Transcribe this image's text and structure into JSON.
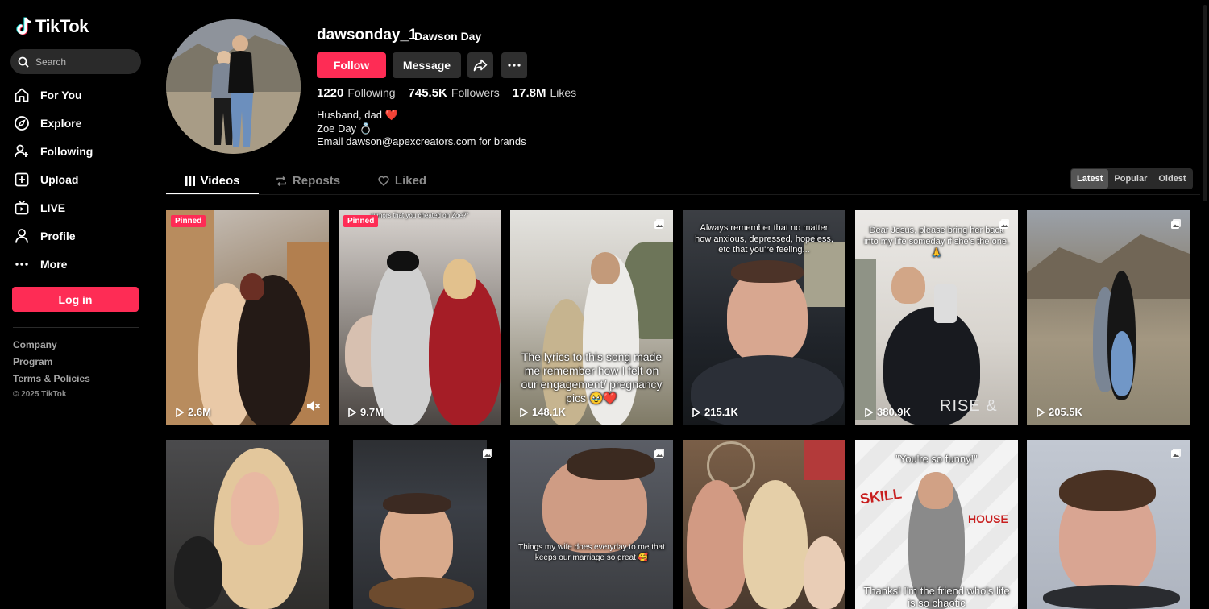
{
  "app": {
    "brand": "TikTok"
  },
  "sidebar": {
    "search_placeholder": "Search",
    "nav": [
      {
        "label": "For You",
        "icon": "home-icon"
      },
      {
        "label": "Explore",
        "icon": "compass-icon"
      },
      {
        "label": "Following",
        "icon": "user-plus-icon"
      },
      {
        "label": "Upload",
        "icon": "upload-icon"
      },
      {
        "label": "LIVE",
        "icon": "live-tv-icon"
      },
      {
        "label": "Profile",
        "icon": "person-icon"
      },
      {
        "label": "More",
        "icon": "more-dots-icon"
      }
    ],
    "login_label": "Log in",
    "footer": {
      "company": "Company",
      "program": "Program",
      "terms": "Terms & Policies",
      "copyright": "© 2025 TikTok"
    }
  },
  "profile": {
    "username": "dawsonday_1",
    "nickname": "Dawson Day",
    "follow_label": "Follow",
    "message_label": "Message",
    "stats": {
      "following_count": "1220",
      "following_label": "Following",
      "followers_count": "745.5K",
      "followers_label": "Followers",
      "likes_count": "17.8M",
      "likes_label": "Likes"
    },
    "bio": {
      "line1": "Husband, dad ❤️",
      "line2": "Zoe Day 💍",
      "line3": "Email dawson@apexcreators.com for brands"
    }
  },
  "tabs": {
    "videos": "Videos",
    "reposts": "Reposts",
    "liked": "Liked"
  },
  "sort": {
    "latest": "Latest",
    "popular": "Popular",
    "oldest": "Oldest"
  },
  "videos": [
    {
      "views": "2.6M",
      "badge": "Pinned",
      "caption": ""
    },
    {
      "views": "9.7M",
      "badge": "Pinned",
      "caption": "rumors that you cheated on Zoe?\""
    },
    {
      "views": "148.1K",
      "caption": "The lyrics to this song made me remember how I felt on our engagement/ pregnancy pics 🥹❤️"
    },
    {
      "views": "215.1K",
      "caption": "Always remember that no matter how anxious, depressed, hopeless, etc that you're feeling..."
    },
    {
      "views": "380.9K",
      "caption": "Dear Jesus, please bring her back into my life someday if she's the one. 🙏",
      "overlay": "RISE &"
    },
    {
      "views": "205.5K",
      "caption": ""
    },
    {
      "caption": ""
    },
    {
      "caption": ""
    },
    {
      "caption": "Things my wife does everyday to me that keeps our marriage so great 🥰"
    },
    {
      "caption": ""
    },
    {
      "caption": "\"You're so funny!\"",
      "caption2": "Thanks! I'm the friend who's life is so chaotic"
    },
    {
      "caption": ""
    }
  ],
  "colors": {
    "accent": "#fe2c55",
    "background": "#000000",
    "button_dark": "#2f2f2f"
  }
}
